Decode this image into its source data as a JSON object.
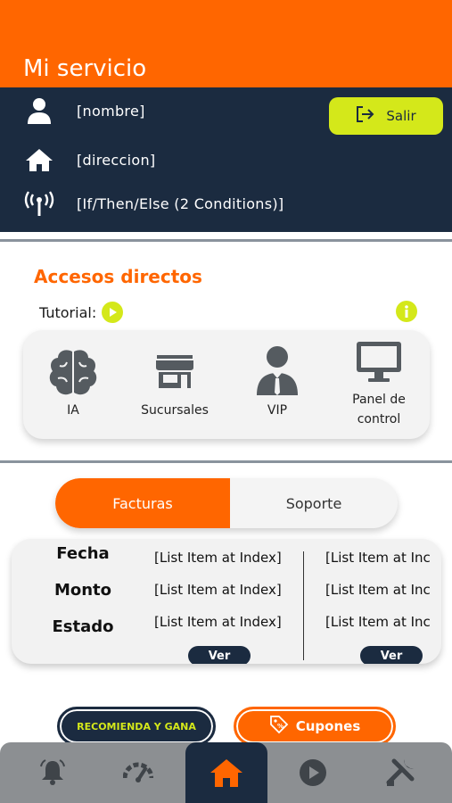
{
  "header": {
    "title": "Mi servicio"
  },
  "profile": {
    "name": "[nombre]",
    "address": "[direccion]",
    "connection": "[If/Then/Else (2 Conditions)]",
    "logout_label": "Salir",
    "icons": [
      "user-icon",
      "home-icon",
      "antenna-icon",
      "logout-icon"
    ]
  },
  "shortcuts": {
    "title": "Accesos directos",
    "tutorial_label": "Tutorial:",
    "items": [
      {
        "label": "IA",
        "icon": "brain-icon"
      },
      {
        "label": "Sucursales",
        "icon": "store-icon"
      },
      {
        "label": "VIP",
        "icon": "vip-user-icon"
      },
      {
        "label_line1": "Panel de",
        "label_line2": "control",
        "icon": "monitor-icon"
      }
    ]
  },
  "tabs": [
    {
      "label": "Facturas",
      "active": true
    },
    {
      "label": "Soporte",
      "active": false
    }
  ],
  "invoices": {
    "labels": {
      "date": "Fecha",
      "amount": "Monto",
      "status": "Estado"
    },
    "columns": [
      {
        "date": "[List Item at Index]",
        "amount": "[List Item at Index]",
        "status": "[List Item at Index]",
        "button": "Ver"
      },
      {
        "date": "[List Item at Inc",
        "amount": "[List Item at Inc",
        "status": "[List Item at Inc",
        "button": "Ver"
      }
    ]
  },
  "promos": {
    "referral_label": "RECOMIENDA Y GANA",
    "coupons_label": "Cupones"
  },
  "nav": {
    "items": [
      "bell-icon",
      "speed-icon",
      "home-icon",
      "play-icon",
      "tools-icon"
    ],
    "active": "home-icon"
  },
  "colors": {
    "brand_orange": "#ff6600",
    "navy": "#1b2b40",
    "lime": "#d4e81a",
    "nav_gray": "#8c8f92"
  }
}
